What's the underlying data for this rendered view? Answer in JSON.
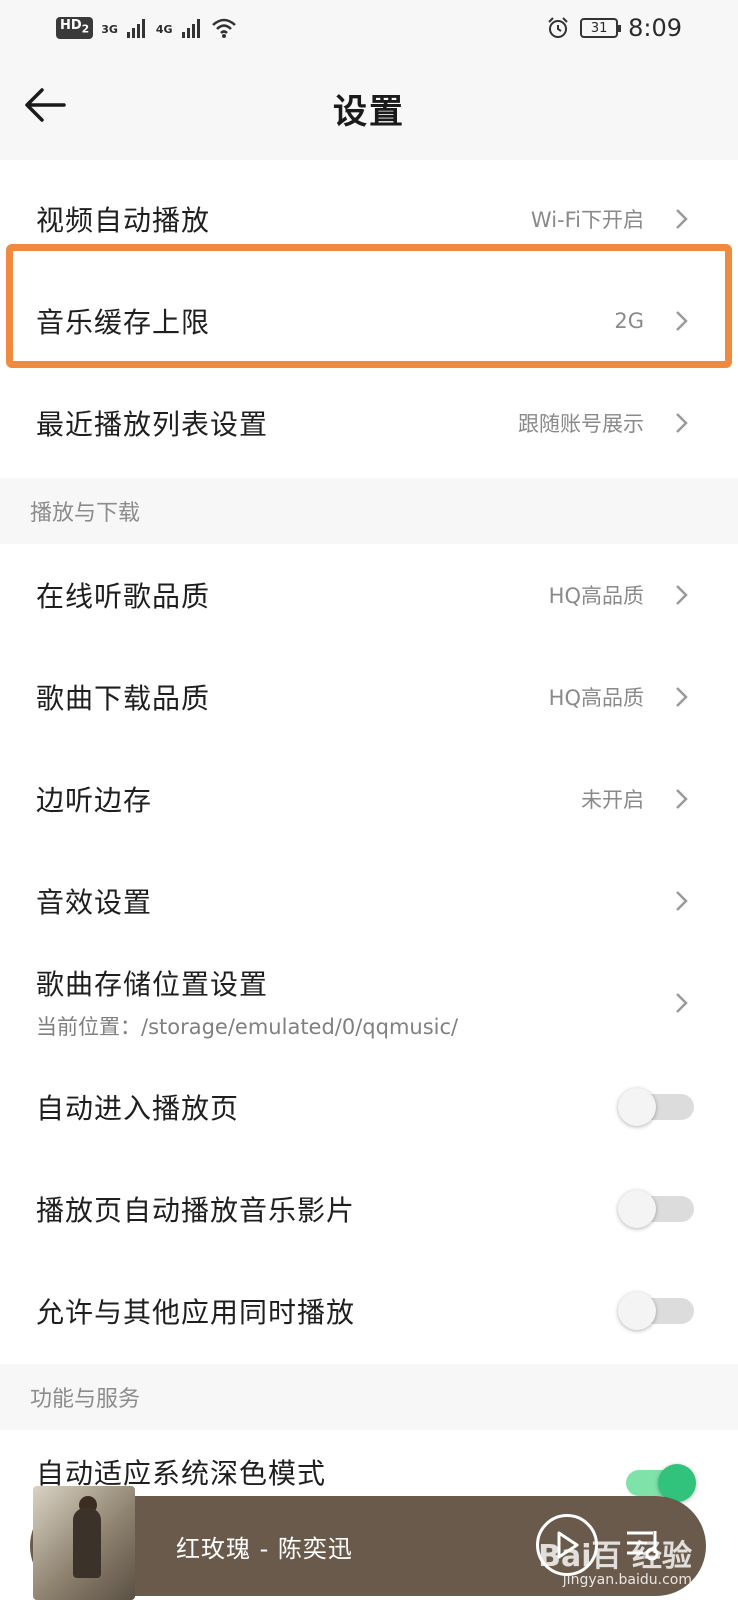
{
  "status_bar": {
    "hd": "HD",
    "hd_sub": "2",
    "net1": "3G",
    "net2": "4G",
    "battery": "31",
    "time": "8:09"
  },
  "header": {
    "title": "设置"
  },
  "rows_top": [
    {
      "label": "视频自动播放",
      "value": "Wi-Fi下开启"
    },
    {
      "label": "音乐缓存上限",
      "value": "2G"
    },
    {
      "label": "最近播放列表设置",
      "value": "跟随账号展示"
    }
  ],
  "section_playback": {
    "title": "播放与下载"
  },
  "rows_playback": [
    {
      "label": "在线听歌品质",
      "value": "HQ高品质"
    },
    {
      "label": "歌曲下载品质",
      "value": "HQ高品质"
    },
    {
      "label": "边听边存",
      "value": "未开启"
    },
    {
      "label": "音效设置",
      "value": ""
    }
  ],
  "storage_row": {
    "label": "歌曲存储位置设置",
    "sub": "当前位置：/storage/emulated/0/qqmusic/"
  },
  "toggles": [
    {
      "label": "自动进入播放页",
      "on": false
    },
    {
      "label": "播放页自动播放音乐影片",
      "on": false
    },
    {
      "label": "允许与其他应用同时播放",
      "on": false
    }
  ],
  "section_services": {
    "title": "功能与服务"
  },
  "dark_mode_row": {
    "label": "自动适应系统深色模式",
    "on": true
  },
  "mini_player": {
    "song": "红玫瑰 - 陈奕迅"
  },
  "watermark": {
    "logo": "Bai百 经验",
    "url": "jingyan.baidu.com"
  },
  "colors": {
    "highlight": "#f08a3e",
    "accent_green": "#31c27c",
    "player_bg": "#6a5a4b"
  }
}
